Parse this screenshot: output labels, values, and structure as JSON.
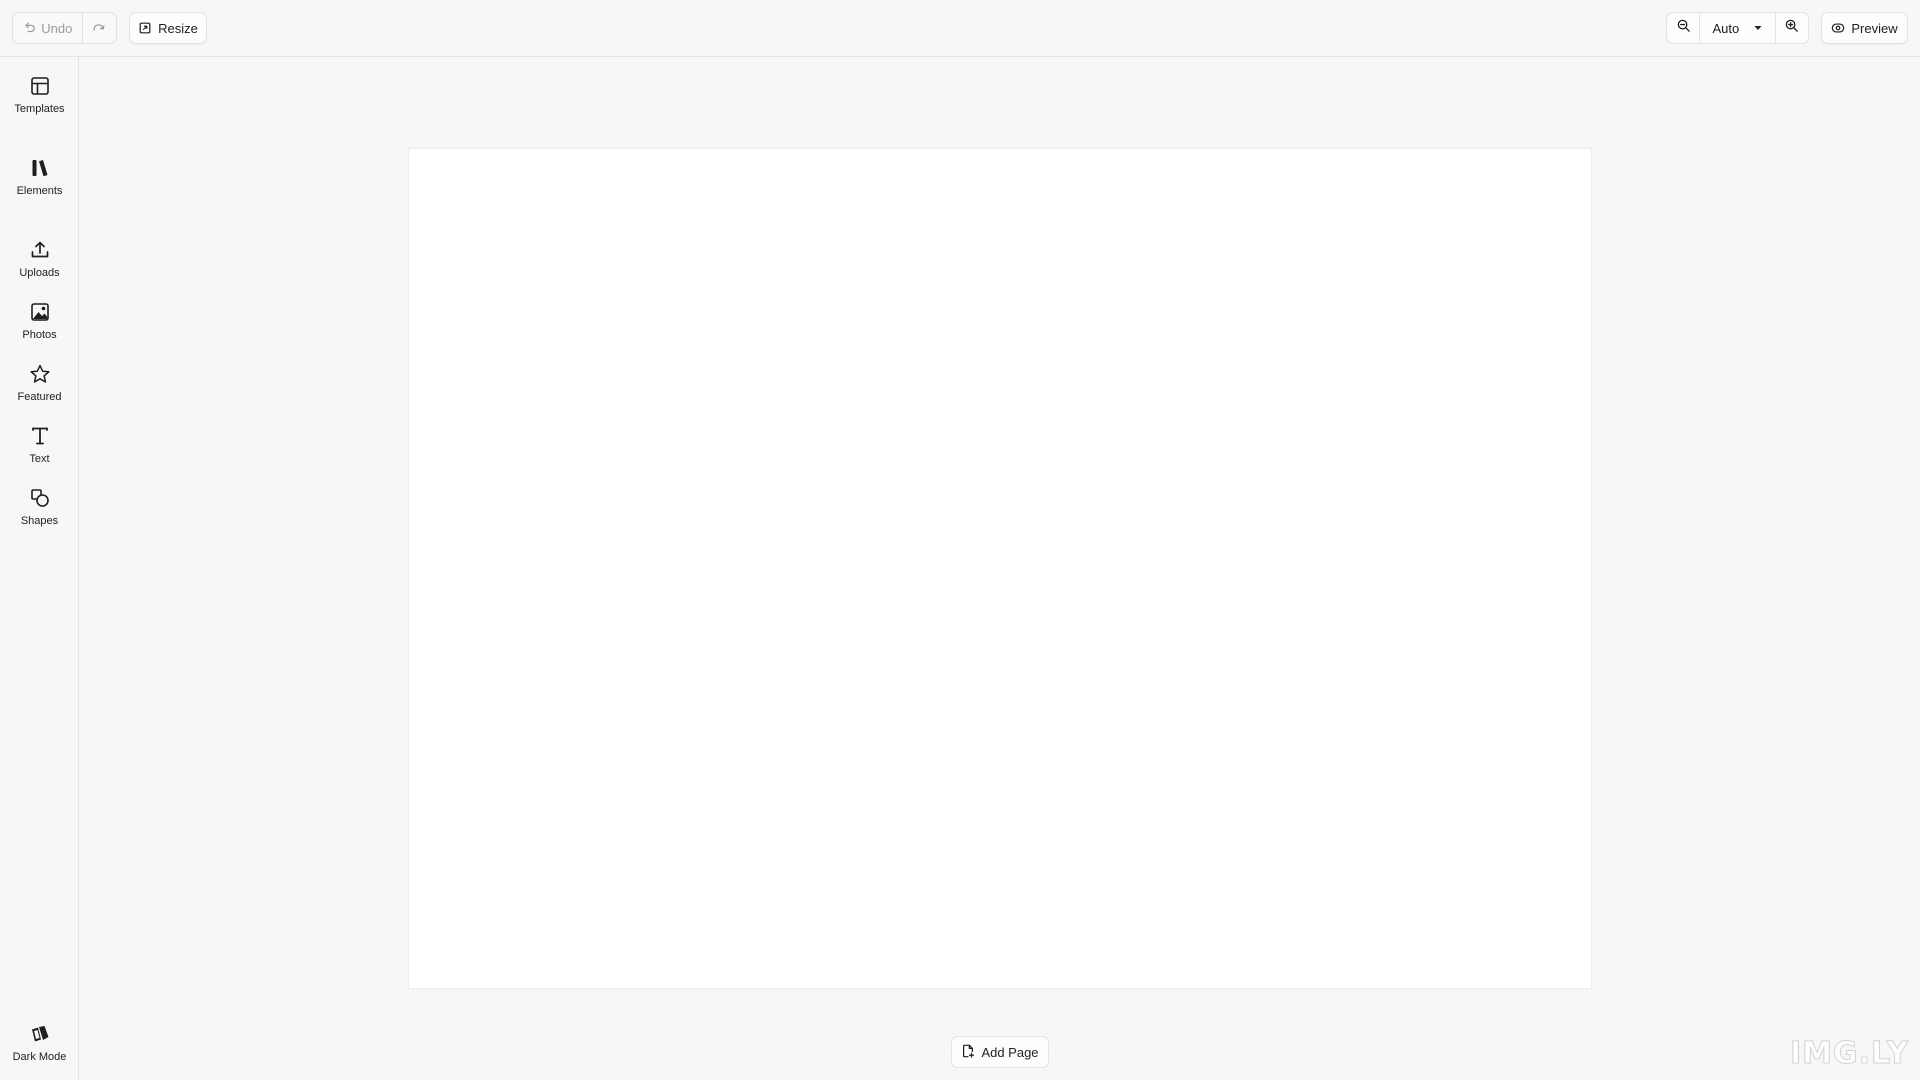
{
  "toolbar": {
    "undo_label": "Undo",
    "resize_label": "Resize",
    "zoom_value": "Auto",
    "preview_label": "Preview"
  },
  "sidebar": {
    "items": [
      {
        "label": "Templates",
        "icon": "layout-icon"
      },
      {
        "label": "Elements",
        "icon": "library-icon"
      },
      {
        "label": "Uploads",
        "icon": "upload-icon"
      },
      {
        "label": "Photos",
        "icon": "image-icon"
      },
      {
        "label": "Featured",
        "icon": "star-icon"
      },
      {
        "label": "Text",
        "icon": "text-icon"
      },
      {
        "label": "Shapes",
        "icon": "shapes-icon"
      }
    ],
    "dark_mode_label": "Dark Mode"
  },
  "canvas": {
    "add_page_label": "Add Page"
  },
  "brand": {
    "logo_text": "IMG.LY"
  }
}
